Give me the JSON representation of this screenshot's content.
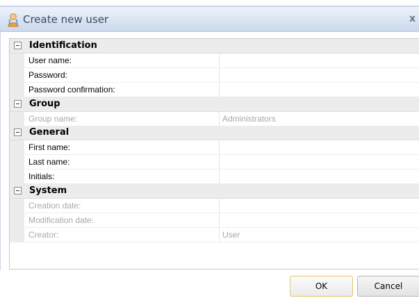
{
  "dialog": {
    "title": "Create new user",
    "close_label": "x",
    "title_icon": "user-icon"
  },
  "grid": {
    "sections": [
      {
        "label": "Identification",
        "expanded": true,
        "rows": [
          {
            "name": "User name:",
            "value": "",
            "disabled": false
          },
          {
            "name": "Password:",
            "value": "",
            "disabled": false
          },
          {
            "name": "Password confirmation:",
            "value": "",
            "disabled": false
          }
        ]
      },
      {
        "label": "Group",
        "expanded": true,
        "rows": [
          {
            "name": "Group name:",
            "value": "Administrators",
            "disabled": true
          }
        ]
      },
      {
        "label": "General",
        "expanded": true,
        "rows": [
          {
            "name": "First name:",
            "value": "",
            "disabled": false
          },
          {
            "name": "Last name:",
            "value": "",
            "disabled": false
          },
          {
            "name": "Initials:",
            "value": "",
            "disabled": false
          }
        ]
      },
      {
        "label": "System",
        "expanded": true,
        "rows": [
          {
            "name": "Creation date:",
            "value": "",
            "disabled": true
          },
          {
            "name": "Modification date:",
            "value": "",
            "disabled": true
          },
          {
            "name": "Creator:",
            "value": "User",
            "disabled": true
          }
        ]
      }
    ]
  },
  "buttons": {
    "ok_label": "OK",
    "cancel_label": "Cancel"
  },
  "colors": {
    "titlebar": "#d9e4f2",
    "category_bg": "#ececec",
    "disabled_text": "#a8a8a8",
    "ok_border": "#e5c365"
  }
}
